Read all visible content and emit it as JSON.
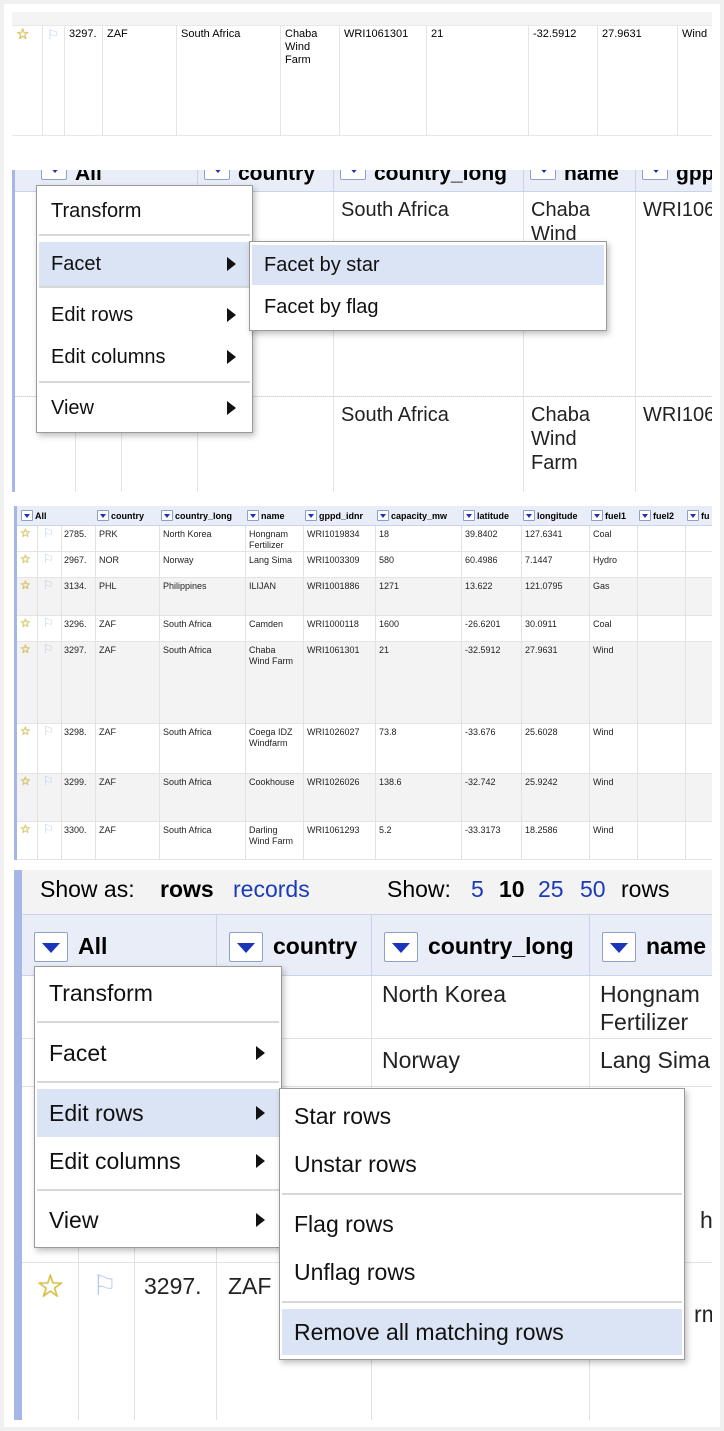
{
  "panel1": {
    "row": {
      "num": "3297.",
      "country": "ZAF",
      "country_long": "South Africa",
      "name": "Chaba\nWind\nFarm",
      "gppd_idnr": "WRI1061301",
      "capacity_mw": "21",
      "latitude": "-32.5912",
      "longitude": "27.9631",
      "fuel1": "Wind"
    }
  },
  "panel2": {
    "headers": {
      "all": "All",
      "country": "country",
      "country_long": "country_long",
      "name": "name",
      "gppd": "gppd"
    },
    "cells": {
      "cl1": "South Africa",
      "nm1": "Chaba\nWind",
      "gp1": "WRI106",
      "cl2": "South Africa",
      "nm2": "Chaba\nWind\nFarm",
      "gp2": "WRI106"
    },
    "menu": {
      "transform": "Transform",
      "facet": "Facet",
      "edit_rows": "Edit rows",
      "edit_columns": "Edit columns",
      "view": "View"
    },
    "submenu": {
      "facet_by_star": "Facet by star",
      "facet_by_flag": "Facet by flag"
    }
  },
  "panel3": {
    "headers": [
      "All",
      "country",
      "country_long",
      "name",
      "gppd_idnr",
      "capacity_mw",
      "latitude",
      "longitude",
      "fuel1",
      "fuel2",
      "fu"
    ],
    "rows": [
      {
        "num": "2785.",
        "country": "PRK",
        "country_long": "North Korea",
        "name": "Hongnam\nFertilizer",
        "gppd_idnr": "WRI1019834",
        "capacity_mw": "18",
        "latitude": "39.8402",
        "longitude": "127.6341",
        "fuel1": "Coal"
      },
      {
        "num": "2967.",
        "country": "NOR",
        "country_long": "Norway",
        "name": "Lang Sima",
        "gppd_idnr": "WRI1003309",
        "capacity_mw": "580",
        "latitude": "60.4986",
        "longitude": "7.1447",
        "fuel1": "Hydro"
      },
      {
        "num": "3134.",
        "country": "PHL",
        "country_long": "Philippines",
        "name": "ILIJAN",
        "gppd_idnr": "WRI1001886",
        "capacity_mw": "1271",
        "latitude": "13.622",
        "longitude": "121.0795",
        "fuel1": "Gas"
      },
      {
        "num": "3296.",
        "country": "ZAF",
        "country_long": "South Africa",
        "name": "Camden",
        "gppd_idnr": "WRI1000118",
        "capacity_mw": "1600",
        "latitude": "-26.6201",
        "longitude": "30.0911",
        "fuel1": "Coal"
      },
      {
        "num": "3297.",
        "country": "ZAF",
        "country_long": "South Africa",
        "name": "Chaba\nWind Farm",
        "gppd_idnr": "WRI1061301",
        "capacity_mw": "21",
        "latitude": "-32.5912",
        "longitude": "27.9631",
        "fuel1": "Wind"
      },
      {
        "num": "3298.",
        "country": "ZAF",
        "country_long": "South Africa",
        "name": "Coega IDZ\nWindfarm",
        "gppd_idnr": "WRI1026027",
        "capacity_mw": "73.8",
        "latitude": "-33.676",
        "longitude": "25.6028",
        "fuel1": "Wind"
      },
      {
        "num": "3299.",
        "country": "ZAF",
        "country_long": "South Africa",
        "name": "Cookhouse",
        "gppd_idnr": "WRI1026026",
        "capacity_mw": "138.6",
        "latitude": "-32.742",
        "longitude": "25.9242",
        "fuel1": "Wind"
      },
      {
        "num": "3300.",
        "country": "ZAF",
        "country_long": "South Africa",
        "name": "Darling\nWind Farm",
        "gppd_idnr": "WRI1061293",
        "capacity_mw": "5.2",
        "latitude": "-33.3173",
        "longitude": "18.2586",
        "fuel1": "Wind"
      }
    ]
  },
  "panel4": {
    "show_as_label": "Show as:",
    "rows_label": "rows",
    "records_label": "records",
    "show_label": "Show:",
    "page_sizes": [
      "5",
      "10",
      "25",
      "50"
    ],
    "rows_suffix": "rows",
    "headers": {
      "all": "All",
      "country": "country",
      "country_long": "country_long",
      "name": "name"
    },
    "cells": {
      "cl1": "North Korea",
      "nm1": "Hongnam\nFertilizer",
      "cl2": "Norway",
      "nm2": "Lang Sima",
      "num": "3297.",
      "country": "ZAF",
      "nm_h": "h",
      "nm_f": "rm"
    },
    "menu": {
      "transform": "Transform",
      "facet": "Facet",
      "edit_rows": "Edit rows",
      "edit_columns": "Edit columns",
      "view": "View"
    },
    "submenu": {
      "star_rows": "Star rows",
      "unstar_rows": "Unstar rows",
      "flag_rows": "Flag rows",
      "unflag_rows": "Unflag rows",
      "remove_all": "Remove all matching rows"
    }
  },
  "icons": {
    "star": "star-icon",
    "flag": "flag-icon",
    "dropdown": "dropdown-arrow-icon",
    "submenu_arrow": "submenu-arrow-icon"
  },
  "colors": {
    "accent_blue": "#1a3bb8",
    "header_bg": "#e9edf7",
    "highlight": "#dbe4f4",
    "left_bar": "#a5b7e8"
  }
}
